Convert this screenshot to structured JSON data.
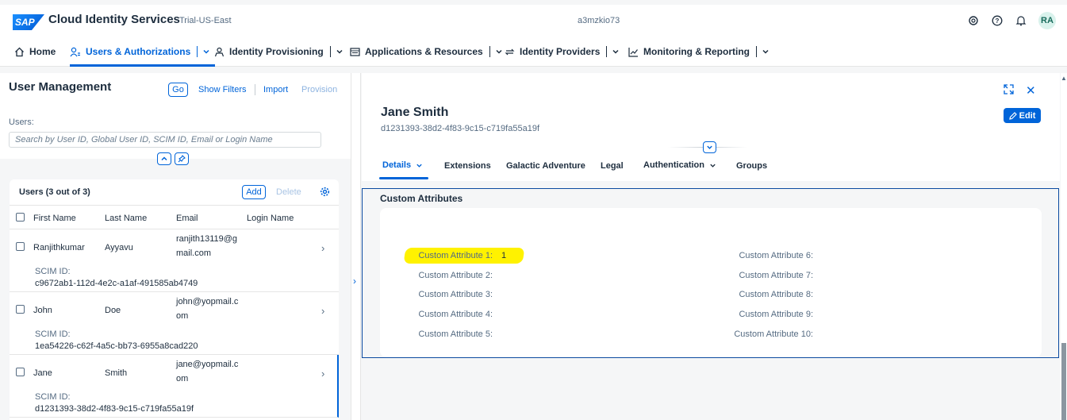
{
  "shell": {
    "logo": "SAP",
    "title": "Cloud Identity Services",
    "subtitle": "Trial-US-East",
    "tenant": "a3mzkio73",
    "avatar_initials": "RA",
    "icons": [
      "support-icon",
      "help-icon",
      "notification-bell-icon"
    ]
  },
  "nav": {
    "items": [
      {
        "label": "Home",
        "icon": "home-icon"
      },
      {
        "label": "Users & Authorizations",
        "icon": "user-settings-icon",
        "active": true
      },
      {
        "label": "Identity Provisioning",
        "icon": "provisioning-icon"
      },
      {
        "label": "Applications & Resources",
        "icon": "applications-icon"
      },
      {
        "label": "Identity Providers",
        "icon": "sync-icon"
      },
      {
        "label": "Monitoring & Reporting",
        "icon": "chart-icon"
      }
    ]
  },
  "user_management": {
    "title": "User Management",
    "go": "Go",
    "show_filters": "Show Filters",
    "import": "Import",
    "provision": "Provision",
    "users_label": "Users:",
    "search_placeholder": "Search by User ID, Global User ID, SCIM ID, Email or Login Name"
  },
  "table": {
    "title": "Users (3 out of 3)",
    "add": "Add",
    "delete": "Delete",
    "columns": [
      "First Name",
      "Last Name",
      "Email",
      "Login Name"
    ],
    "scim_label": "SCIM ID:",
    "rows": [
      {
        "first": "Ranjithkumar",
        "last": "Ayyavu",
        "email": "ranjith13119@gmail.com",
        "scim": "c9672ab1-112d-4e2c-a1af-491585ab4749"
      },
      {
        "first": "John",
        "last": "Doe",
        "email": "john@yopmail.com",
        "scim": "1ea54226-c62f-4a5c-bb73-6955a8cad220"
      },
      {
        "first": "Jane",
        "last": "Smith",
        "email": "jane@yopmail.com",
        "scim": "d1231393-38d2-4f83-9c15-c719fa55a19f"
      }
    ]
  },
  "detail": {
    "name": "Jane Smith",
    "id": "d1231393-38d2-4f83-9c15-c719fa55a19f",
    "edit": "Edit",
    "tabs": [
      "Details",
      "Extensions",
      "Galactic Adventure",
      "Legal",
      "Authentication",
      "Groups"
    ],
    "section_title": "Custom Attributes",
    "attributes_left": [
      {
        "label": "Custom Attribute 1:",
        "value": "1"
      },
      {
        "label": "Custom Attribute 2:",
        "value": ""
      },
      {
        "label": "Custom Attribute 3:",
        "value": ""
      },
      {
        "label": "Custom Attribute 4:",
        "value": ""
      },
      {
        "label": "Custom Attribute 5:",
        "value": ""
      }
    ],
    "attributes_right": [
      {
        "label": "Custom Attribute 6:",
        "value": ""
      },
      {
        "label": "Custom Attribute 7:",
        "value": ""
      },
      {
        "label": "Custom Attribute 8:",
        "value": ""
      },
      {
        "label": "Custom Attribute 9:",
        "value": ""
      },
      {
        "label": "Custom Attribute 10:",
        "value": ""
      }
    ]
  },
  "colors": {
    "accent": "#0064d9",
    "highlight": "#fff200"
  }
}
